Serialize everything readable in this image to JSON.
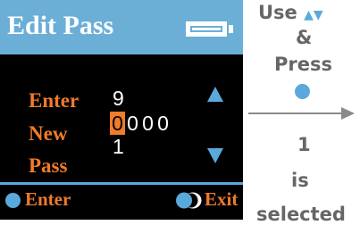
{
  "title_bar": {
    "title": "Edit Pass"
  },
  "form": {
    "labels": [
      "Enter",
      "New",
      "Pass"
    ],
    "current_value": "9",
    "new_digits": [
      "0",
      "0",
      "0",
      "0"
    ],
    "selected_digit_index": 0,
    "pending_value": "1"
  },
  "footer": {
    "enter_label": "Enter",
    "exit_label": "Exit"
  },
  "annotation": {
    "use": "Use",
    "arrows": "▲▼",
    "ampersand": "&",
    "press": "Press",
    "number": "1",
    "is": "is",
    "selected": "selected"
  },
  "colors": {
    "title_bar": "#6baed6",
    "label_orange": "#f07b2a",
    "accent_blue": "#5aa9dc",
    "screen_bg": "#000000",
    "annotation_gray": "#666666"
  },
  "icons": {
    "battery": "battery-full-icon",
    "up": "up-arrow-icon",
    "down": "down-arrow-icon",
    "enter": "enter-dot-icon",
    "exit": "exit-toggle-icon",
    "press": "press-dot-icon",
    "pointer": "right-arrow-icon"
  }
}
